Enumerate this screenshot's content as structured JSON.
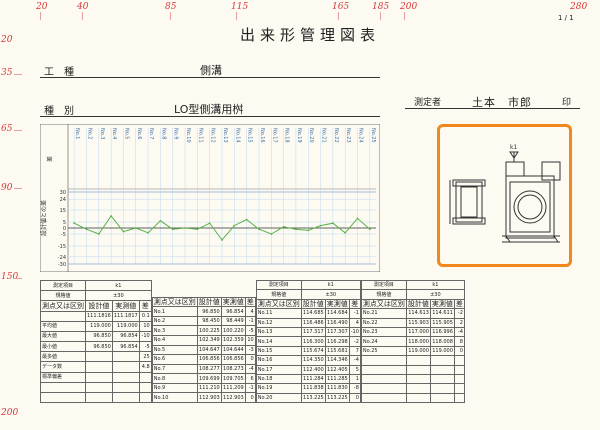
{
  "header": {
    "title": "出来形管理図表",
    "page": "1 / 1",
    "work_label": "工　種",
    "work_value": "側溝",
    "type_label": "種　別",
    "type_value": "LO型側溝用桝",
    "measurer_label": "測定者",
    "measurer_name": "土本　市郎",
    "seal": "印"
  },
  "rulers": {
    "top": [
      "20",
      "40",
      "85",
      "115",
      "165",
      "185",
      "200",
      "280"
    ],
    "left": [
      "20",
      "35",
      "65",
      "90",
      "150",
      "200"
    ]
  },
  "chart_data": {
    "type": "line",
    "ylabel": "設計値との差",
    "y_top_label": "差",
    "categories": [
      "No.1",
      "No.2",
      "No.3",
      "No.4",
      "No.5",
      "No.6",
      "No.7",
      "No.8",
      "No.9",
      "No.10",
      "No.11",
      "No.12",
      "No.13",
      "No.14",
      "No.15",
      "No.16",
      "No.17",
      "No.18",
      "No.19",
      "No.20",
      "No.21",
      "No.22",
      "No.23",
      "No.24",
      "No.25"
    ],
    "values": [
      4,
      -1,
      -5,
      10,
      -3,
      0,
      -4,
      6,
      -1,
      0,
      -1,
      4,
      -10,
      2,
      7,
      -1,
      -5,
      1,
      -1,
      -2,
      2,
      4,
      -4,
      8,
      -1
    ],
    "ylim": [
      -30,
      30
    ],
    "yticks": [
      "30",
      "24",
      "15",
      "5",
      "0",
      "-5",
      "-15",
      "-24",
      "-30"
    ],
    "limit_upper": 30,
    "limit_lower": -30,
    "grid": true
  },
  "diagram": {
    "label": "k1"
  },
  "tables": [
    {
      "title_label": "測定項目",
      "item": "k1",
      "std_label": "規格値",
      "std": "±30",
      "col1": "測点又は区別",
      "col2": "設計値",
      "col3": "実測値",
      "col4": "差",
      "rows": [
        [
          "No.1",
          "96.850",
          "96.854",
          "4"
        ],
        [
          "No.2",
          "98.450",
          "98.449",
          "-1"
        ],
        [
          "No.3",
          "100.225",
          "100.220",
          "-5"
        ],
        [
          "No.4",
          "102.349",
          "102.359",
          "10"
        ],
        [
          "No.5",
          "104.647",
          "104.644",
          "-3"
        ],
        [
          "No.6",
          "106.856",
          "106.856",
          "0"
        ],
        [
          "No.7",
          "108.277",
          "108.273",
          "-4"
        ],
        [
          "No.8",
          "109.699",
          "109.705",
          "6"
        ],
        [
          "No.9",
          "111.210",
          "111.209",
          "-1"
        ],
        [
          "No.10",
          "112.903",
          "112.903",
          "0"
        ]
      ],
      "summary": {
        "col1": "測点又は区別",
        "col2": "設計値",
        "col3": "実測値",
        "col4": "差",
        "rows": [
          [
            "",
            "111.1816",
            "111.1817",
            "0.1"
          ],
          [
            "平均値",
            "119.000",
            "119.000",
            "10"
          ],
          [
            "最大値",
            "96.850",
            "96.854",
            "-10"
          ],
          [
            "最小値",
            "96.850",
            "96.854",
            "-5"
          ],
          [
            "最多値",
            "",
            "",
            "25"
          ],
          [
            "データ数",
            "",
            "",
            "4.8"
          ],
          [
            "標準偏差",
            "",
            "",
            ""
          ],
          [
            "",
            "",
            "",
            ""
          ],
          [
            "",
            "",
            "",
            ""
          ]
        ]
      }
    },
    {
      "title_label": "測定項目",
      "item": "k1",
      "std_label": "規格値",
      "std": "±30",
      "col1": "測点又は区別",
      "col2": "設計値",
      "col3": "実測値",
      "col4": "差",
      "rows": [
        [
          "No.11",
          "114.685",
          "114.684",
          "-1"
        ],
        [
          "No.12",
          "116.486",
          "116.490",
          "4"
        ],
        [
          "No.13",
          "117.317",
          "117.307",
          "-10"
        ],
        [
          "No.14",
          "116.300",
          "116.298",
          "-2"
        ],
        [
          "No.15",
          "115.674",
          "115.681",
          "7"
        ],
        [
          "No.16",
          "114.350",
          "114.346",
          "-4"
        ],
        [
          "No.17",
          "112.400",
          "112.405",
          "5"
        ],
        [
          "No.18",
          "111.284",
          "111.285",
          "1"
        ],
        [
          "No.19",
          "111.838",
          "111.830",
          "-8"
        ],
        [
          "No.20",
          "113.225",
          "113.225",
          "0"
        ]
      ]
    },
    {
      "title_label": "測定項目",
      "item": "k1",
      "std_label": "規格値",
      "std": "±30",
      "col1": "測点又は区別",
      "col2": "設計値",
      "col3": "実測値",
      "col4": "差",
      "rows": [
        [
          "No.21",
          "114.613",
          "114.611",
          "-2"
        ],
        [
          "No.22",
          "115.903",
          "115.905",
          "2"
        ],
        [
          "No.23",
          "117.000",
          "116.996",
          "-4"
        ],
        [
          "No.24",
          "118.000",
          "118.008",
          "8"
        ],
        [
          "No.25",
          "119.000",
          "119.000",
          "0"
        ],
        [
          "",
          "",
          "",
          ""
        ],
        [
          "",
          "",
          "",
          ""
        ],
        [
          "",
          "",
          "",
          ""
        ],
        [
          "",
          "",
          "",
          ""
        ],
        [
          "",
          "",
          "",
          ""
        ]
      ]
    }
  ]
}
